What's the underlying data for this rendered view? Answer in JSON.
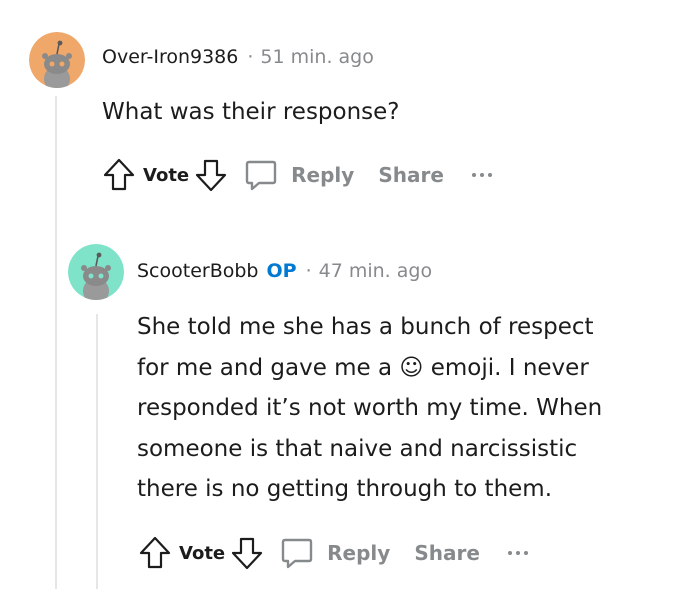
{
  "comments": [
    {
      "username": "Over-Iron9386",
      "op_badge": "",
      "separator": "·",
      "timestamp": "51 min. ago",
      "body": "What was their response?",
      "avatar_color": "#f0a76a",
      "actions": {
        "vote": "Vote",
        "reply": "Reply",
        "share": "Share"
      }
    },
    {
      "username": "ScooterBobb",
      "op_badge": "OP",
      "separator": "·",
      "timestamp": "47 min. ago",
      "body_lines": [
        "She told me she has a bunch of respect",
        "for me and gave me a ☺ emoji. I never",
        "responded it’s not worth my time. When",
        "someone is that naive and narcissistic",
        "there is no getting through to them."
      ],
      "avatar_color": "#7ee3c9",
      "actions": {
        "vote": "Vote",
        "reply": "Reply",
        "share": "Share"
      }
    }
  ],
  "icons": {
    "upvote": "arrow-up-outline",
    "downvote": "arrow-down-outline",
    "reply": "speech-bubble-outline",
    "more": "three-dots-horizontal"
  },
  "colors": {
    "op": "#0079d3",
    "muted": "#878a8c",
    "text": "#1c1c1c",
    "thread_line": "#e4e6e8"
  }
}
